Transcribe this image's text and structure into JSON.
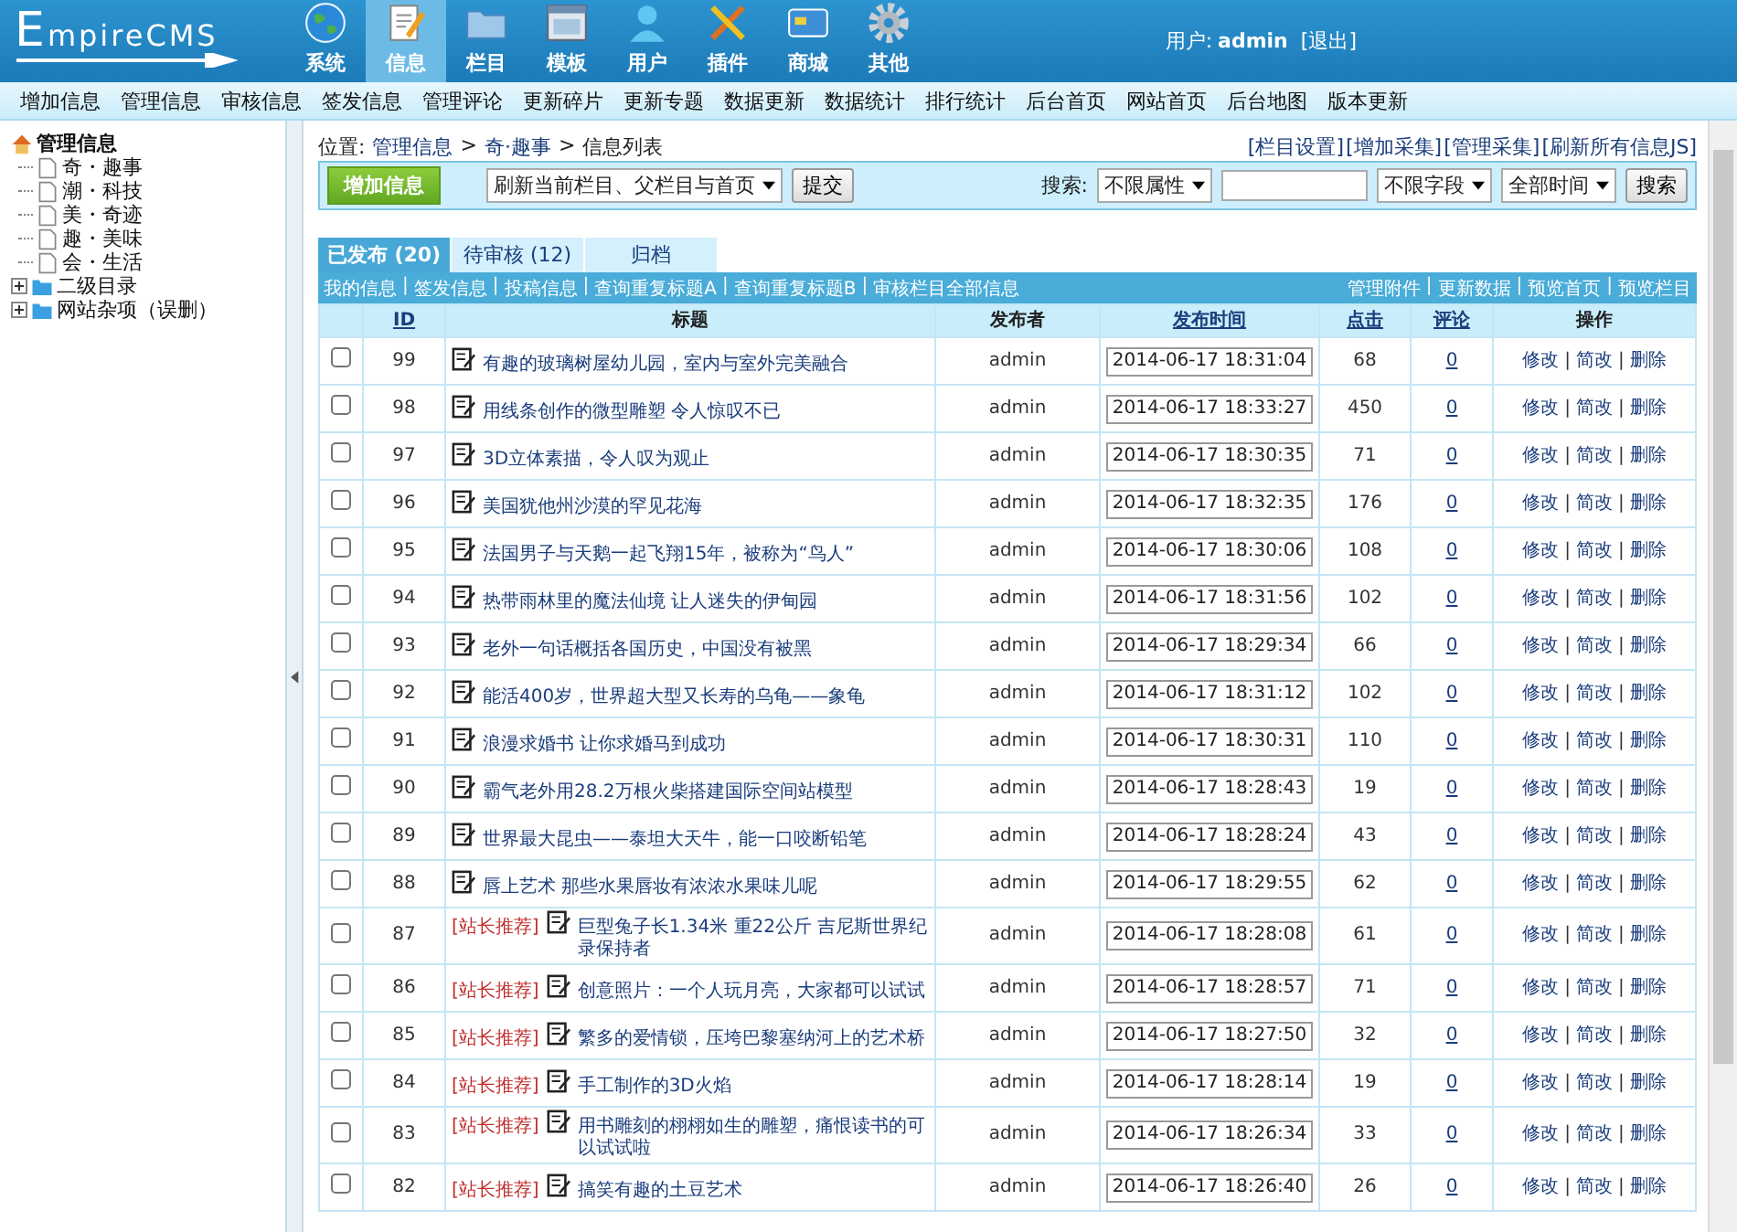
{
  "header": {
    "logo": "EmpireCMS",
    "nav": [
      {
        "label": "系统",
        "kind": "globe",
        "selected": false
      },
      {
        "label": "信息",
        "kind": "pencil",
        "selected": true
      },
      {
        "label": "栏目",
        "kind": "folder",
        "selected": false
      },
      {
        "label": "模板",
        "kind": "window",
        "selected": false
      },
      {
        "label": "用户",
        "kind": "person",
        "selected": false
      },
      {
        "label": "插件",
        "kind": "tools",
        "selected": false
      },
      {
        "label": "商城",
        "kind": "card",
        "selected": false
      },
      {
        "label": "其他",
        "kind": "gear",
        "selected": false
      }
    ],
    "user_label": "用户:",
    "user": "admin",
    "logout": "[退出]"
  },
  "menu": [
    "增加信息",
    "管理信息",
    "审核信息",
    "签发信息",
    "管理评论",
    "更新碎片",
    "更新专题",
    "数据更新",
    "数据统计",
    "排行统计",
    "后台首页",
    "网站首页",
    "后台地图",
    "版本更新"
  ],
  "sidebar": {
    "tree": [
      {
        "label": "管理信息",
        "kind": "home",
        "expanded": true,
        "children": [
          {
            "label": "奇・趣事",
            "kind": "page"
          },
          {
            "label": "潮・科技",
            "kind": "page"
          },
          {
            "label": "美・奇迹",
            "kind": "page"
          },
          {
            "label": "趣・美味",
            "kind": "page"
          },
          {
            "label": "会・生活",
            "kind": "page"
          }
        ]
      },
      {
        "label": "二级目录",
        "kind": "folder",
        "expanded": false
      },
      {
        "label": "网站杂项（误删）",
        "kind": "folder",
        "expanded": false
      }
    ]
  },
  "location": {
    "prefix": "位置:",
    "separator": ">",
    "crumbs": [
      "管理信息",
      "奇·趣事",
      "信息列表"
    ]
  },
  "top_links": [
    "[栏目设置]",
    "[增加采集]",
    "[管理采集]",
    "[刷新所有信息JS]"
  ],
  "toolbar": {
    "add_button": "增加信息",
    "refresh_select": "刷新当前栏目、父栏目与首页",
    "submit": "提交",
    "search_label": "搜索:",
    "attribute_select": "不限属性",
    "field_select": "不限字段",
    "time_select": "全部时间",
    "search_button": "搜索"
  },
  "tabs": [
    {
      "label": "已发布 (20)",
      "selected": true
    },
    {
      "label": "待审核 (12)",
      "selected": false
    },
    {
      "label": "归档",
      "selected": false
    }
  ],
  "link_bar": {
    "separator": "|",
    "left": [
      "我的信息",
      "签发信息",
      "投稿信息",
      "查询重复标题A",
      "查询重复标题B",
      "审核栏目全部信息"
    ],
    "right": [
      "管理附件",
      "更新数据",
      "预览首页",
      "预览栏目"
    ]
  },
  "table": {
    "columns": [
      {
        "label": "ID",
        "sortable": true
      },
      {
        "label": "标题",
        "sortable": false
      },
      {
        "label": "发布者",
        "sortable": false
      },
      {
        "label": "发布时间",
        "sortable": true
      },
      {
        "label": "点击",
        "sortable": true
      },
      {
        "label": "评论",
        "sortable": true
      },
      {
        "label": "操作",
        "sortable": false
      }
    ],
    "rows": [
      {
        "checked": false,
        "id": "99",
        "title": "有趣的玻璃树屋幼儿园，室内与室外完美融合",
        "publisher": "admin",
        "time": "2014-06-17 18:31:04",
        "clicks": "68",
        "comments": "0",
        "actions": [
          "修改",
          "简改",
          "删除"
        ]
      },
      {
        "checked": false,
        "id": "98",
        "title": "用线条创作的微型雕塑 令人惊叹不已",
        "publisher": "admin",
        "time": "2014-06-17 18:33:27",
        "clicks": "450",
        "comments": "0",
        "actions": [
          "修改",
          "简改",
          "删除"
        ]
      },
      {
        "checked": false,
        "id": "97",
        "title": "3D立体素描，令人叹为观止",
        "publisher": "admin",
        "time": "2014-06-17 18:30:35",
        "clicks": "71",
        "comments": "0",
        "actions": [
          "修改",
          "简改",
          "删除"
        ]
      },
      {
        "checked": false,
        "id": "96",
        "title": "美国犹他州沙漠的罕见花海",
        "publisher": "admin",
        "time": "2014-06-17 18:32:35",
        "clicks": "176",
        "comments": "0",
        "actions": [
          "修改",
          "简改",
          "删除"
        ]
      },
      {
        "checked": false,
        "id": "95",
        "title": "法国男子与天鹅一起飞翔15年，被称为“鸟人”",
        "publisher": "admin",
        "time": "2014-06-17 18:30:06",
        "clicks": "108",
        "comments": "0",
        "actions": [
          "修改",
          "简改",
          "删除"
        ]
      },
      {
        "checked": false,
        "id": "94",
        "title": "热带雨林里的魔法仙境 让人迷失的伊甸园",
        "publisher": "admin",
        "time": "2014-06-17 18:31:56",
        "clicks": "102",
        "comments": "0",
        "actions": [
          "修改",
          "简改",
          "删除"
        ]
      },
      {
        "checked": false,
        "id": "93",
        "title": "老外一句话概括各国历史，中国没有被黑",
        "publisher": "admin",
        "time": "2014-06-17 18:29:34",
        "clicks": "66",
        "comments": "0",
        "actions": [
          "修改",
          "简改",
          "删除"
        ]
      },
      {
        "checked": false,
        "id": "92",
        "title": "能活400岁，世界超大型又长寿的乌龟——象龟",
        "publisher": "admin",
        "time": "2014-06-17 18:31:12",
        "clicks": "102",
        "comments": "0",
        "actions": [
          "修改",
          "简改",
          "删除"
        ]
      },
      {
        "checked": false,
        "id": "91",
        "title": "浪漫求婚书 让你求婚马到成功",
        "publisher": "admin",
        "time": "2014-06-17 18:30:31",
        "clicks": "110",
        "comments": "0",
        "actions": [
          "修改",
          "简改",
          "删除"
        ]
      },
      {
        "checked": false,
        "id": "90",
        "title": "霸气老外用28.2万根火柴搭建国际空间站模型",
        "publisher": "admin",
        "time": "2014-06-17 18:28:43",
        "clicks": "19",
        "comments": "0",
        "actions": [
          "修改",
          "简改",
          "删除"
        ]
      },
      {
        "checked": false,
        "id": "89",
        "title": "世界最大昆虫——泰坦大天牛，能一口咬断铅笔",
        "publisher": "admin",
        "time": "2014-06-17 18:28:24",
        "clicks": "43",
        "comments": "0",
        "actions": [
          "修改",
          "简改",
          "删除"
        ]
      },
      {
        "checked": false,
        "id": "88",
        "title": "唇上艺术 那些水果唇妆有浓浓水果味儿呢",
        "publisher": "admin",
        "time": "2014-06-17 18:29:55",
        "clicks": "62",
        "comments": "0",
        "actions": [
          "修改",
          "简改",
          "删除"
        ]
      },
      {
        "checked": false,
        "id": "87",
        "tag": "[站长推荐]",
        "title": "巨型兔子长1.34米 重22公斤 吉尼斯世界纪录保持者",
        "publisher": "admin",
        "time": "2014-06-17 18:28:08",
        "clicks": "61",
        "comments": "0",
        "actions": [
          "修改",
          "简改",
          "删除"
        ]
      },
      {
        "checked": false,
        "id": "86",
        "tag": "[站长推荐]",
        "title": "创意照片：一个人玩月亮，大家都可以试试",
        "publisher": "admin",
        "time": "2014-06-17 18:28:57",
        "clicks": "71",
        "comments": "0",
        "actions": [
          "修改",
          "简改",
          "删除"
        ]
      },
      {
        "checked": false,
        "id": "85",
        "tag": "[站长推荐]",
        "title": "繁多的爱情锁，压垮巴黎塞纳河上的艺术桥",
        "publisher": "admin",
        "time": "2014-06-17 18:27:50",
        "clicks": "32",
        "comments": "0",
        "actions": [
          "修改",
          "简改",
          "删除"
        ]
      },
      {
        "checked": false,
        "id": "84",
        "tag": "[站长推荐]",
        "title": "手工制作的3D火焰",
        "publisher": "admin",
        "time": "2014-06-17 18:28:14",
        "clicks": "19",
        "comments": "0",
        "actions": [
          "修改",
          "简改",
          "删除"
        ]
      },
      {
        "checked": false,
        "id": "83",
        "tag": "[站长推荐]",
        "title": "用书雕刻的栩栩如生的雕塑，痛恨读书的可以试试啦",
        "publisher": "admin",
        "time": "2014-06-17 18:26:34",
        "clicks": "33",
        "comments": "0",
        "actions": [
          "修改",
          "简改",
          "删除"
        ]
      },
      {
        "checked": false,
        "id": "82",
        "tag": "[站长推荐]",
        "title": "搞笑有趣的土豆艺术",
        "publisher": "admin",
        "time": "2014-06-17 18:26:40",
        "clicks": "26",
        "comments": "0",
        "actions": [
          "修改",
          "简改",
          "删除"
        ]
      }
    ]
  }
}
